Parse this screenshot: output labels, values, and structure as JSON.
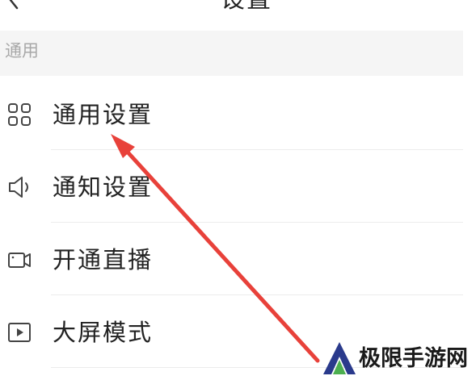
{
  "header": {
    "title": "设置",
    "back_icon": "chevron-left-icon"
  },
  "section": {
    "label": "通用"
  },
  "menu": [
    {
      "label": "通用设置",
      "icon": "grid-icon"
    },
    {
      "label": "通知设置",
      "icon": "speaker-icon"
    },
    {
      "label": "开通直播",
      "icon": "video-camera-icon"
    },
    {
      "label": "大屏模式",
      "icon": "play-screen-icon"
    }
  ],
  "annotation": {
    "arrow_color": "#e8413a",
    "arrow_target": "menu.0"
  },
  "watermark": {
    "text": "极限手游网",
    "logo_icon": "watermark-logo-icon",
    "logo_colors": [
      "#2a3a8c",
      "#4caf50"
    ]
  }
}
